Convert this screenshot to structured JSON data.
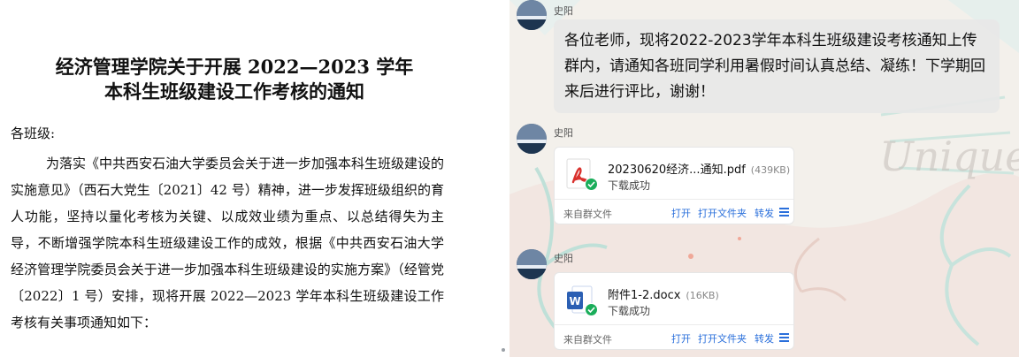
{
  "document": {
    "title_line1": "经济管理学院关于开展 2022—2023 学年",
    "title_line2": "本科生班级建设工作考核的通知",
    "greeting": "各班级:",
    "body": "为落实《中共西安石油大学委员会关于进一步加强本科生班级建设的实施意见》（西石大党生〔2021〕42 号）精神，进一步发挥班级组织的育人功能，坚持以量化考核为关键、以成效业绩为重点、以总结得失为主导，不断增强学院本科生班级建设工作的成效，根据《中共西安石油大学经济管理学院委员会关于进一步加强本科生班级建设的实施方案》（经管党〔2022〕1 号）安排，现将开展 2022—2023 学年本科生班级建设工作考核有关事项通知如下："
  },
  "chat": {
    "messages": [
      {
        "sender": "史阳",
        "text": "各位老师，现将2022-2023学年本科生班级建设考核通知上传群内，请通知各班同学利用暑假时间认真总结、凝练！下学期回来后进行评比，谢谢！"
      },
      {
        "sender": "史阳",
        "file_name": "20230620经济...通知.pdf",
        "file_size": "(439KB)",
        "status": "下载成功",
        "source": "来自群文件",
        "file_icon": "pdf-icon"
      },
      {
        "sender": "史阳",
        "file_name": "附件1-2.docx",
        "file_size": "(16KB)",
        "status": "下载成功",
        "source": "来自群文件",
        "file_icon": "word-icon"
      }
    ],
    "actions": {
      "open": "打开",
      "open_folder": "打开文件夹",
      "forward": "转发"
    },
    "background_text": "Unique",
    "colors": {
      "link": "#2a6fdb",
      "success": "#1aad5a",
      "pdf": "#d9302c",
      "word": "#2b5fb3"
    }
  }
}
